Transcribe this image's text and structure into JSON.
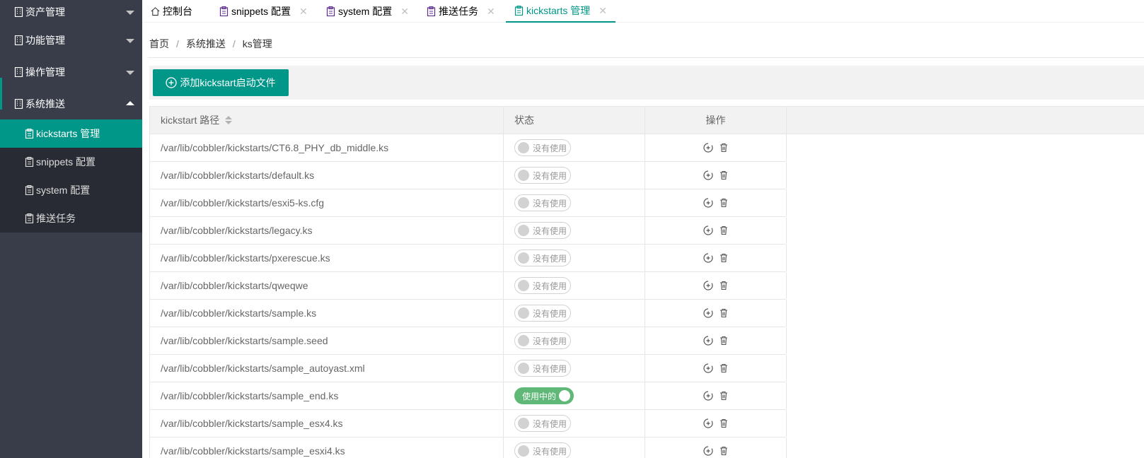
{
  "sidebar": {
    "groups": [
      {
        "label": "资产管理",
        "icon": "building-icon"
      },
      {
        "label": "功能管理",
        "icon": "building-icon"
      },
      {
        "label": "操作管理",
        "icon": "building-icon"
      },
      {
        "label": "系统推送",
        "icon": "building-icon"
      }
    ],
    "sub_items": [
      {
        "label": "kickstarts 管理",
        "icon": "clipboard-icon"
      },
      {
        "label": "snippets 配置",
        "icon": "clipboard-icon"
      },
      {
        "label": "system 配置",
        "icon": "clipboard-icon"
      },
      {
        "label": "推送任务",
        "icon": "clipboard-icon"
      }
    ]
  },
  "tabs": [
    {
      "label": "控制台",
      "icon": "home-icon"
    },
    {
      "label": "snippets 配置",
      "icon": "clipboard-icon",
      "close": "✕"
    },
    {
      "label": "system 配置",
      "icon": "clipboard-icon",
      "close": "✕"
    },
    {
      "label": "推送任务",
      "icon": "clipboard-icon",
      "close": "✕"
    },
    {
      "label": "kickstarts 管理",
      "icon": "clipboard-icon",
      "close": "✕"
    }
  ],
  "breadcrumb": {
    "items": [
      "首页",
      "系统推送",
      "ks管理"
    ],
    "separator": "/"
  },
  "toolbar": {
    "add_label": "添加kickstart启动文件"
  },
  "table": {
    "headers": {
      "path": "kickstart 路径",
      "status": "状态",
      "action": "操作"
    },
    "status_off": "没有使用",
    "status_on": "使用中的",
    "rows": [
      {
        "path": "/var/lib/cobbler/kickstarts/CT6.8_PHY_db_middle.ks",
        "active": false
      },
      {
        "path": "/var/lib/cobbler/kickstarts/default.ks",
        "active": false
      },
      {
        "path": "/var/lib/cobbler/kickstarts/esxi5-ks.cfg",
        "active": false
      },
      {
        "path": "/var/lib/cobbler/kickstarts/legacy.ks",
        "active": false
      },
      {
        "path": "/var/lib/cobbler/kickstarts/pxerescue.ks",
        "active": false
      },
      {
        "path": "/var/lib/cobbler/kickstarts/qweqwe",
        "active": false
      },
      {
        "path": "/var/lib/cobbler/kickstarts/sample.ks",
        "active": false
      },
      {
        "path": "/var/lib/cobbler/kickstarts/sample.seed",
        "active": false
      },
      {
        "path": "/var/lib/cobbler/kickstarts/sample_autoyast.xml",
        "active": false
      },
      {
        "path": "/var/lib/cobbler/kickstarts/sample_end.ks",
        "active": true
      },
      {
        "path": "/var/lib/cobbler/kickstarts/sample_esx4.ks",
        "active": false
      },
      {
        "path": "/var/lib/cobbler/kickstarts/sample_esxi4.ks",
        "active": false
      }
    ]
  },
  "colors": {
    "accent": "#009688",
    "sidebar": "#393d49",
    "submenu": "#282b33",
    "switch_on": "#5fb878"
  }
}
